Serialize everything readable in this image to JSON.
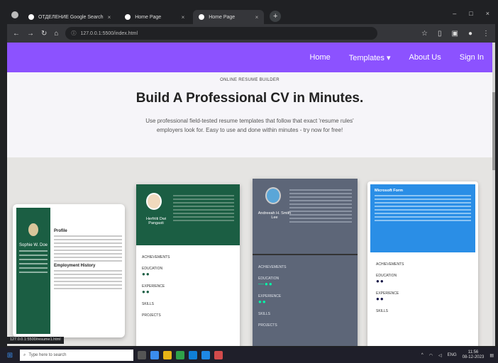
{
  "browser": {
    "tabs": [
      {
        "label": "ОТДЕЛЕНИЕ Google Search"
      },
      {
        "label": "Home Page"
      },
      {
        "label": "Home Page"
      }
    ],
    "new_tab": "+",
    "window_controls": [
      "–",
      "□",
      "×"
    ],
    "url": "127.0.0.1:5500/index.html"
  },
  "nav": {
    "items": [
      "Home",
      "Templates ▾",
      "About Us",
      "Sign In"
    ]
  },
  "hero": {
    "eyebrow": "ONLINE RESUME BUILDER",
    "title": "Build A Professional CV in Minutes.",
    "subtitle": "Use professional field-tested resume templates that follow that exact 'resume rules' employers look for. Easy to use and done within minutes - try now for free!"
  },
  "templates": [
    {
      "name": "Sophie W. Doe",
      "sections": [
        "Profile",
        "Employment History"
      ]
    },
    {
      "name": "Herfriiti Dwi Pangasti",
      "sections": [
        "ACHIEVEMENTS",
        "EDUCATION",
        "EXPERIENCE",
        "SKILLS",
        "PROJECTS"
      ]
    },
    {
      "name": "Andreeah H. Smith Lee",
      "sections": [
        "ACHIEVEMENTS",
        "EDUCATION",
        "EXPERIENCE",
        "SKILLS",
        "PROJECTS"
      ]
    },
    {
      "name": "Microsoft Form",
      "sections": [
        "ACHIEVEMENTS",
        "EDUCATION",
        "EXPERIENCE",
        "SKILLS"
      ]
    }
  ],
  "status_text": "127.0.0.1:5500/resume1.html",
  "taskbar": {
    "search_placeholder": "Type here to search",
    "time": "11:56",
    "date": "08-12-2023",
    "lang": "ENG"
  },
  "colors": {
    "nav": "#8c52ff",
    "template_green": "#1b5e43",
    "template_slate": "#5d6678",
    "template_blue": "#2a8ee6"
  }
}
